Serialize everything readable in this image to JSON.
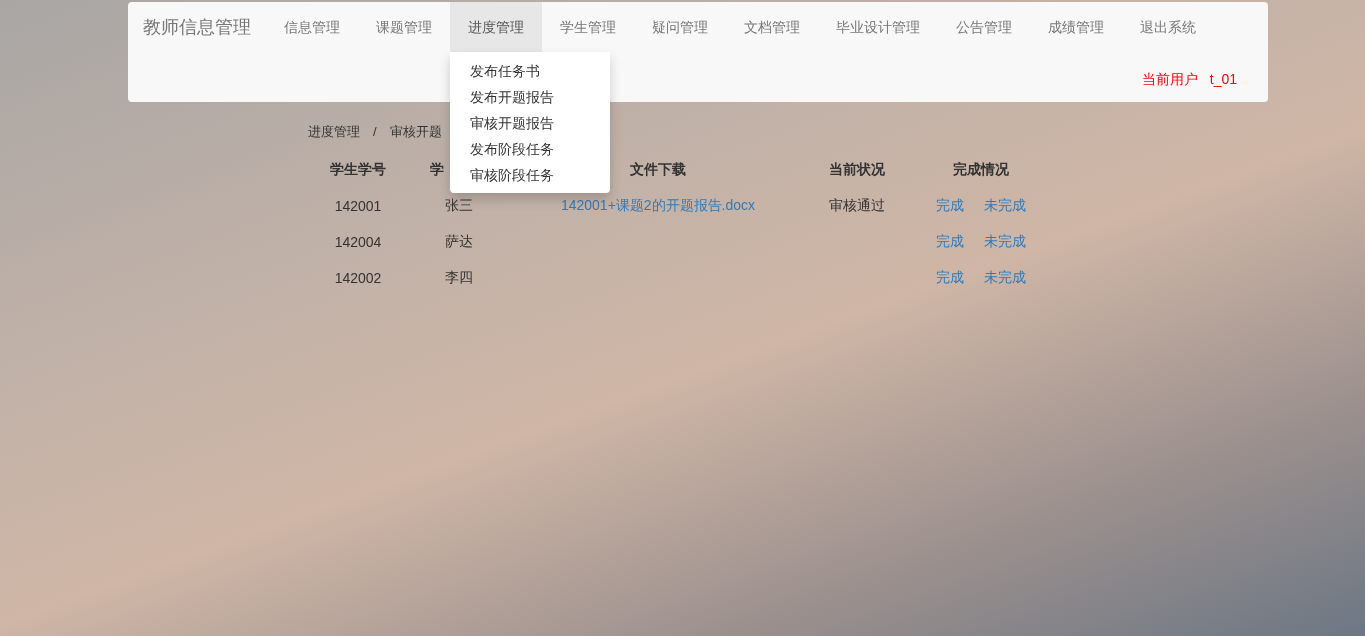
{
  "brand": "教师信息管理",
  "nav": [
    {
      "label": "信息管理",
      "selected": false
    },
    {
      "label": "课题管理",
      "selected": false
    },
    {
      "label": "进度管理",
      "selected": true,
      "menu": [
        "发布任务书",
        "发布开题报告",
        "审核开题报告",
        "发布阶段任务",
        "审核阶段任务"
      ]
    },
    {
      "label": "学生管理",
      "selected": false
    },
    {
      "label": "疑问管理",
      "selected": false
    },
    {
      "label": "文档管理",
      "selected": false
    },
    {
      "label": "毕业设计管理",
      "selected": false
    },
    {
      "label": "公告管理",
      "selected": false
    },
    {
      "label": "成绩管理",
      "selected": false
    },
    {
      "label": "退出系统",
      "selected": false
    }
  ],
  "current_user": {
    "label": "当前用户",
    "value": "t_01"
  },
  "breadcrumb": [
    "进度管理",
    "/",
    "审核开题"
  ],
  "table": {
    "columns": [
      "学生学号",
      "学",
      "文件下载",
      "当前状况",
      "完成情况"
    ],
    "rows": [
      {
        "id": "142001",
        "name": "张三",
        "file": "142001+课题2的开题报告.docx",
        "status": "审核通过",
        "actions": [
          "完成",
          "未完成"
        ]
      },
      {
        "id": "142004",
        "name": "萨达",
        "actions": [
          "完成",
          "未完成"
        ]
      },
      {
        "id": "142002",
        "name": "李四",
        "actions": [
          "完成",
          "未完成"
        ]
      }
    ]
  }
}
